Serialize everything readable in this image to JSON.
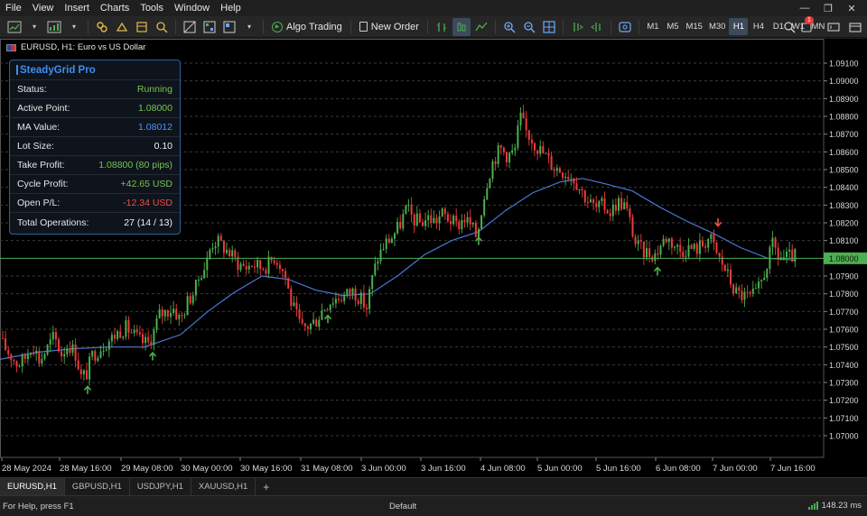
{
  "menu": [
    "File",
    "View",
    "Insert",
    "Charts",
    "Tools",
    "Window",
    "Help"
  ],
  "window_controls": [
    "—",
    "❐",
    "✕"
  ],
  "toolbar": {
    "algo_trading_label": "Algo Trading",
    "new_order_label": "New Order",
    "timeframes": [
      "M1",
      "M5",
      "M15",
      "M30",
      "H1",
      "H4",
      "D1",
      "W1",
      "MN"
    ],
    "active_timeframe": "H1",
    "notification_count": "1"
  },
  "chart": {
    "title": "EURUSD, H1:  Euro vs US Dollar"
  },
  "panel": {
    "title": "SteadyGrid Pro",
    "rows": [
      {
        "label": "Status:",
        "value": "Running",
        "color": "#74c452"
      },
      {
        "label": "Active Point:",
        "value": "1.08000",
        "color": "#74c452"
      },
      {
        "label": "MA Value:",
        "value": "1.08012",
        "color": "#4d92ff"
      },
      {
        "label": "Lot Size:",
        "value": "0.10",
        "color": "#f0f0f0"
      },
      {
        "label": "Take Profit:",
        "value": "1.08800 (80 pips)",
        "color": "#74c452"
      },
      {
        "label": "Cycle Profit:",
        "value": "+42.65 USD",
        "color": "#74c452"
      },
      {
        "label": "Open P/L:",
        "value": "-12.34 USD",
        "color": "#ef4b4b"
      },
      {
        "label": "Total Operations:",
        "value": "27 (14 / 13)",
        "color": "#f0f0f0"
      }
    ]
  },
  "chart_data": {
    "type": "candlestick",
    "symbol": "EURUSD",
    "timeframe": "H1",
    "ylim": [
      1.069,
      1.092
    ],
    "y_ticks": [
      "1.09100",
      "1.09000",
      "1.08900",
      "1.08800",
      "1.08700",
      "1.08600",
      "1.08500",
      "1.08400",
      "1.08300",
      "1.08200",
      "1.08100",
      "1.07900",
      "1.07800",
      "1.07700",
      "1.07600",
      "1.07500",
      "1.07400",
      "1.07300",
      "1.07200",
      "1.07100",
      "1.07000"
    ],
    "current_price": "1.08000",
    "x_ticks": [
      "28 May 2024",
      "28 May 16:00",
      "29 May 08:00",
      "30 May 00:00",
      "30 May 16:00",
      "31 May 08:00",
      "3 Jun 00:00",
      "3 Jun 16:00",
      "4 Jun 08:00",
      "5 Jun 00:00",
      "5 Jun 16:00",
      "6 Jun 08:00",
      "7 Jun 00:00",
      "7 Jun 16:00"
    ],
    "price_path": [
      [
        0,
        1.0755
      ],
      [
        10,
        1.0748
      ],
      [
        22,
        1.074
      ],
      [
        30,
        1.0744
      ],
      [
        38,
        1.0752
      ],
      [
        46,
        1.0742
      ],
      [
        54,
        1.0749
      ],
      [
        62,
        1.0756
      ],
      [
        70,
        1.0746
      ],
      [
        78,
        1.0752
      ],
      [
        86,
        1.0746
      ],
      [
        92,
        1.0733
      ],
      [
        98,
        1.0735
      ],
      [
        104,
        1.0745
      ],
      [
        110,
        1.0748
      ],
      [
        118,
        1.0752
      ],
      [
        126,
        1.0755
      ],
      [
        134,
        1.0759
      ],
      [
        142,
        1.0761
      ],
      [
        150,
        1.0757
      ],
      [
        158,
        1.0753
      ],
      [
        166,
        1.0752
      ],
      [
        172,
        1.0758
      ],
      [
        178,
        1.0768
      ],
      [
        186,
        1.077
      ],
      [
        194,
        1.0772
      ],
      [
        202,
        1.0765
      ],
      [
        210,
        1.0776
      ],
      [
        218,
        1.0782
      ],
      [
        224,
        1.0792
      ],
      [
        230,
        1.0796
      ],
      [
        236,
        1.0808
      ],
      [
        242,
        1.081
      ],
      [
        250,
        1.0806
      ],
      [
        258,
        1.0802
      ],
      [
        266,
        1.0797
      ],
      [
        274,
        1.0795
      ],
      [
        282,
        1.0797
      ],
      [
        290,
        1.0795
      ],
      [
        298,
        1.0796
      ],
      [
        306,
        1.0801
      ],
      [
        312,
        1.0797
      ],
      [
        318,
        1.079
      ],
      [
        324,
        1.0776
      ],
      [
        330,
        1.0768
      ],
      [
        336,
        1.076
      ],
      [
        344,
        1.0762
      ],
      [
        352,
        1.0765
      ],
      [
        360,
        1.0772
      ],
      [
        368,
        1.0776
      ],
      [
        376,
        1.0778
      ],
      [
        384,
        1.0779
      ],
      [
        392,
        1.0782
      ],
      [
        400,
        1.0778
      ],
      [
        408,
        1.0772
      ],
      [
        414,
        1.0788
      ],
      [
        420,
        1.08
      ],
      [
        428,
        1.0808
      ],
      [
        436,
        1.0812
      ],
      [
        444,
        1.0818
      ],
      [
        452,
        1.0828
      ],
      [
        460,
        1.0822
      ],
      [
        468,
        1.082
      ],
      [
        476,
        1.0823
      ],
      [
        484,
        1.0821
      ],
      [
        492,
        1.0825
      ],
      [
        500,
        1.0822
      ],
      [
        508,
        1.0818
      ],
      [
        516,
        1.0823
      ],
      [
        524,
        1.0818
      ],
      [
        530,
        1.0812
      ],
      [
        536,
        1.083
      ],
      [
        542,
        1.0845
      ],
      [
        548,
        1.0855
      ],
      [
        556,
        1.0862
      ],
      [
        564,
        1.0858
      ],
      [
        572,
        1.086
      ],
      [
        578,
        1.088
      ],
      [
        584,
        1.0872
      ],
      [
        590,
        1.0868
      ],
      [
        598,
        1.0862
      ],
      [
        606,
        1.0858
      ],
      [
        614,
        1.0852
      ],
      [
        622,
        1.085
      ],
      [
        630,
        1.0848
      ],
      [
        638,
        1.0845
      ],
      [
        646,
        1.0838
      ],
      [
        654,
        1.0832
      ],
      [
        662,
        1.0828
      ],
      [
        670,
        1.083
      ],
      [
        678,
        1.0826
      ],
      [
        686,
        1.0832
      ],
      [
        694,
        1.083
      ],
      [
        700,
        1.082
      ],
      [
        706,
        1.0808
      ],
      [
        714,
        1.0804
      ],
      [
        722,
        1.0803
      ],
      [
        728,
        1.0802
      ],
      [
        734,
        1.0808
      ],
      [
        740,
        1.0812
      ],
      [
        748,
        1.0808
      ],
      [
        756,
        1.0804
      ],
      [
        764,
        1.0806
      ],
      [
        772,
        1.0805
      ],
      [
        780,
        1.0808
      ],
      [
        788,
        1.0812
      ],
      [
        796,
        1.0802
      ],
      [
        804,
        1.0795
      ],
      [
        810,
        1.0788
      ],
      [
        816,
        1.0781
      ],
      [
        824,
        1.0779
      ],
      [
        832,
        1.0778
      ],
      [
        840,
        1.078
      ],
      [
        846,
        1.0788
      ],
      [
        852,
        1.0798
      ],
      [
        858,
        1.0808
      ],
      [
        864,
        1.0801
      ],
      [
        872,
        1.08
      ],
      [
        880,
        1.0801
      ]
    ],
    "ma_path": [
      [
        0,
        1.0743
      ],
      [
        40,
        1.0747
      ],
      [
        80,
        1.0749
      ],
      [
        120,
        1.075
      ],
      [
        160,
        1.075
      ],
      [
        200,
        1.0757
      ],
      [
        230,
        1.077
      ],
      [
        260,
        1.0781
      ],
      [
        290,
        1.079
      ],
      [
        320,
        1.0788
      ],
      [
        350,
        1.0782
      ],
      [
        380,
        1.0779
      ],
      [
        410,
        1.078
      ],
      [
        440,
        1.079
      ],
      [
        470,
        1.0802
      ],
      [
        500,
        1.081
      ],
      [
        530,
        1.0815
      ],
      [
        560,
        1.0827
      ],
      [
        590,
        1.0837
      ],
      [
        620,
        1.0843
      ],
      [
        645,
        1.0845
      ],
      [
        670,
        1.0842
      ],
      [
        700,
        1.0838
      ],
      [
        730,
        1.0829
      ],
      [
        760,
        1.0821
      ],
      [
        790,
        1.0814
      ],
      [
        820,
        1.0806
      ],
      [
        850,
        1.08
      ],
      [
        880,
        1.0799
      ]
    ],
    "buy_arrows": [
      [
        97,
        1.0726
      ],
      [
        169,
        1.0745
      ],
      [
        363,
        1.0766
      ],
      [
        530,
        1.081
      ],
      [
        728,
        1.0793
      ]
    ],
    "sell_arrows": [
      [
        795,
        1.082
      ]
    ]
  },
  "tabs": [
    "EURUSD,H1",
    "GBPUSD,H1",
    "USDJPY,H1",
    "XAUUSD,H1"
  ],
  "active_tab": "EURUSD,H1",
  "status": {
    "help": "For Help, press F1",
    "profile": "Default",
    "ping": "148.23 ms"
  }
}
